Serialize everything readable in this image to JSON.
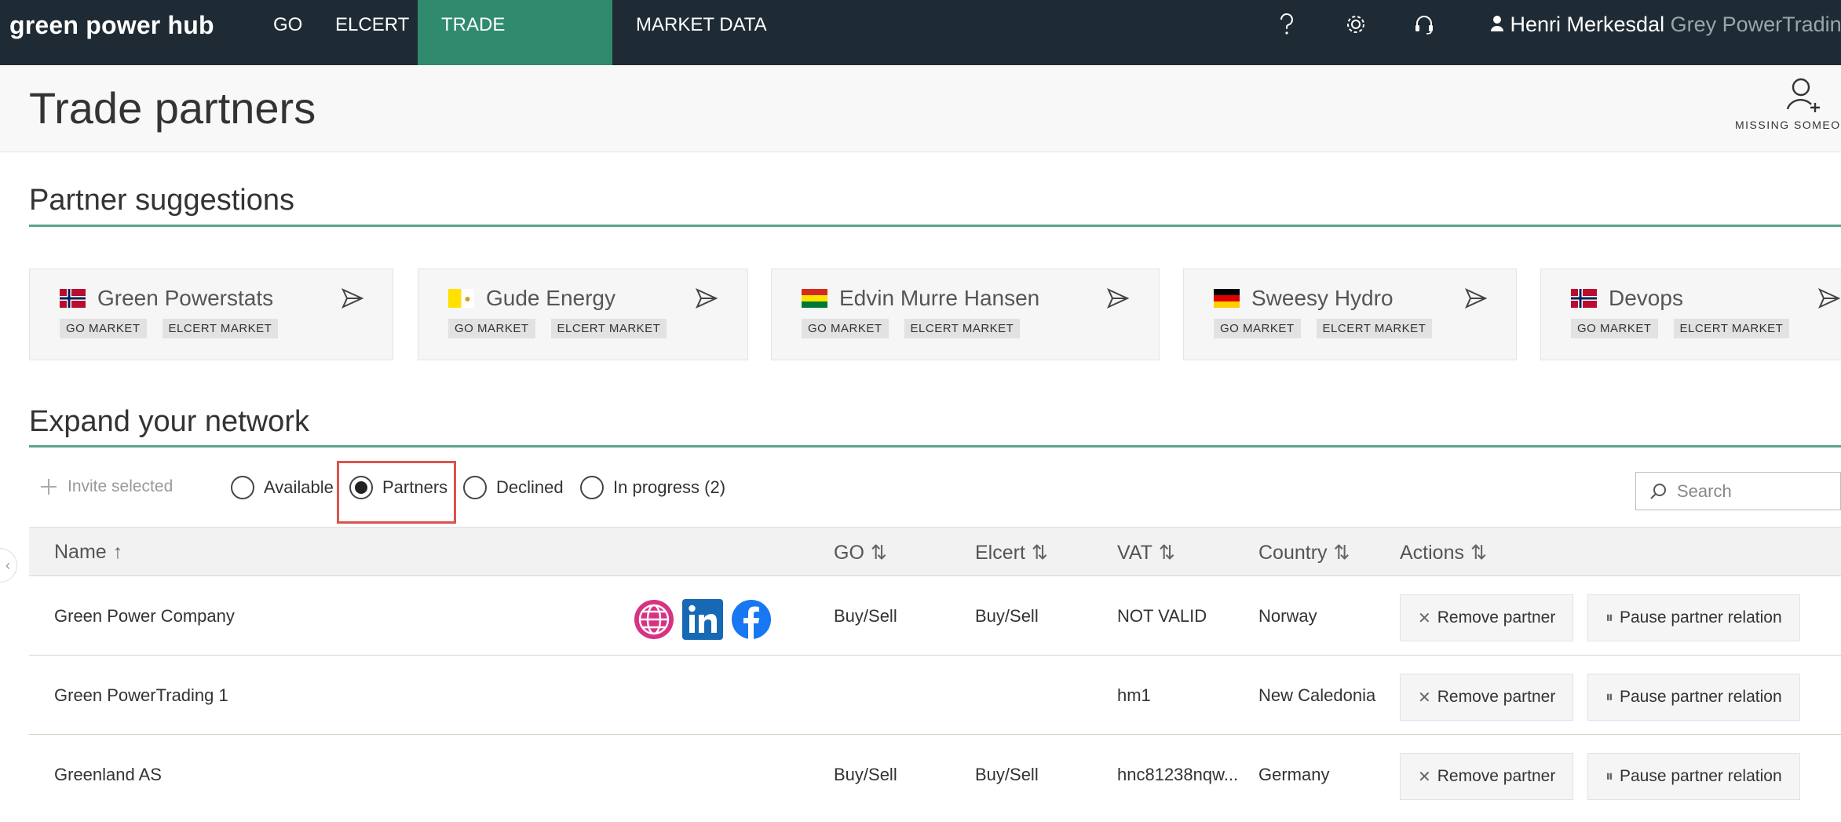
{
  "app": {
    "logo": "green power hub",
    "nav": [
      {
        "label": "GO",
        "active": false
      },
      {
        "label": "ELCERT",
        "active": false
      },
      {
        "label": "TRADE PARTNERS",
        "active": true
      },
      {
        "label": "MARKET DATA",
        "active": false
      }
    ],
    "icons": [
      "help-icon",
      "gear-icon",
      "headset-icon",
      "user-icon"
    ],
    "user_name": "Henri Merkesdal",
    "user_org": "Grey PowerTrading"
  },
  "header": {
    "title": "Trade partners",
    "missing_label": "MISSING SOMEO"
  },
  "suggestions": {
    "title": "Partner suggestions",
    "cards": [
      {
        "name": "Green Powerstats",
        "flag": "norway",
        "tags": [
          "GO MARKET",
          "ELCERT MARKET"
        ]
      },
      {
        "name": "Gude Energy",
        "flag": "vatican",
        "tags": [
          "GO MARKET",
          "ELCERT MARKET"
        ]
      },
      {
        "name": "Edvin Murre Hansen",
        "flag": "bolivia",
        "tags": [
          "GO MARKET",
          "ELCERT MARKET"
        ]
      },
      {
        "name": "Sweesy Hydro",
        "flag": "germany",
        "tags": [
          "GO MARKET",
          "ELCERT MARKET"
        ]
      },
      {
        "name": "Devops",
        "flag": "norway",
        "tags": [
          "GO MARKET",
          "ELCERT MARKET"
        ]
      }
    ]
  },
  "network": {
    "title": "Expand your network",
    "invite_label": "Invite selected",
    "filters": [
      {
        "label": "Available",
        "selected": false
      },
      {
        "label": "Partners",
        "selected": true
      },
      {
        "label": "Declined",
        "selected": false
      },
      {
        "label": "In progress (2)",
        "selected": false
      }
    ],
    "search_placeholder": "Search",
    "columns": {
      "name": "Name",
      "go": "GO",
      "elcert": "Elcert",
      "vat": "VAT",
      "country": "Country",
      "actions": "Actions"
    },
    "sort_icons": {
      "asc": "↑",
      "both": "⇅"
    },
    "rows": [
      {
        "name": "Green Power Company",
        "go": "Buy/Sell",
        "elcert": "Buy/Sell",
        "vat": "NOT VALID",
        "country": "Norway",
        "social": [
          "globe-icon",
          "linkedin-icon",
          "facebook-icon"
        ]
      },
      {
        "name": "Green PowerTrading 1",
        "go": "",
        "elcert": "",
        "vat": "hm1",
        "country": "New Caledonia",
        "social": []
      },
      {
        "name": "Greenland AS",
        "go": "Buy/Sell",
        "elcert": "Buy/Sell",
        "vat": "hnc81238nqw...",
        "country": "Germany",
        "social": []
      }
    ],
    "remove_label": "Remove partner",
    "pause_label": "Pause partner relation"
  },
  "colors": {
    "topbar": "#1f2b34",
    "active_tab": "#2f8a6e",
    "rule": "#5aa48c",
    "highlight": "#d9534f"
  }
}
